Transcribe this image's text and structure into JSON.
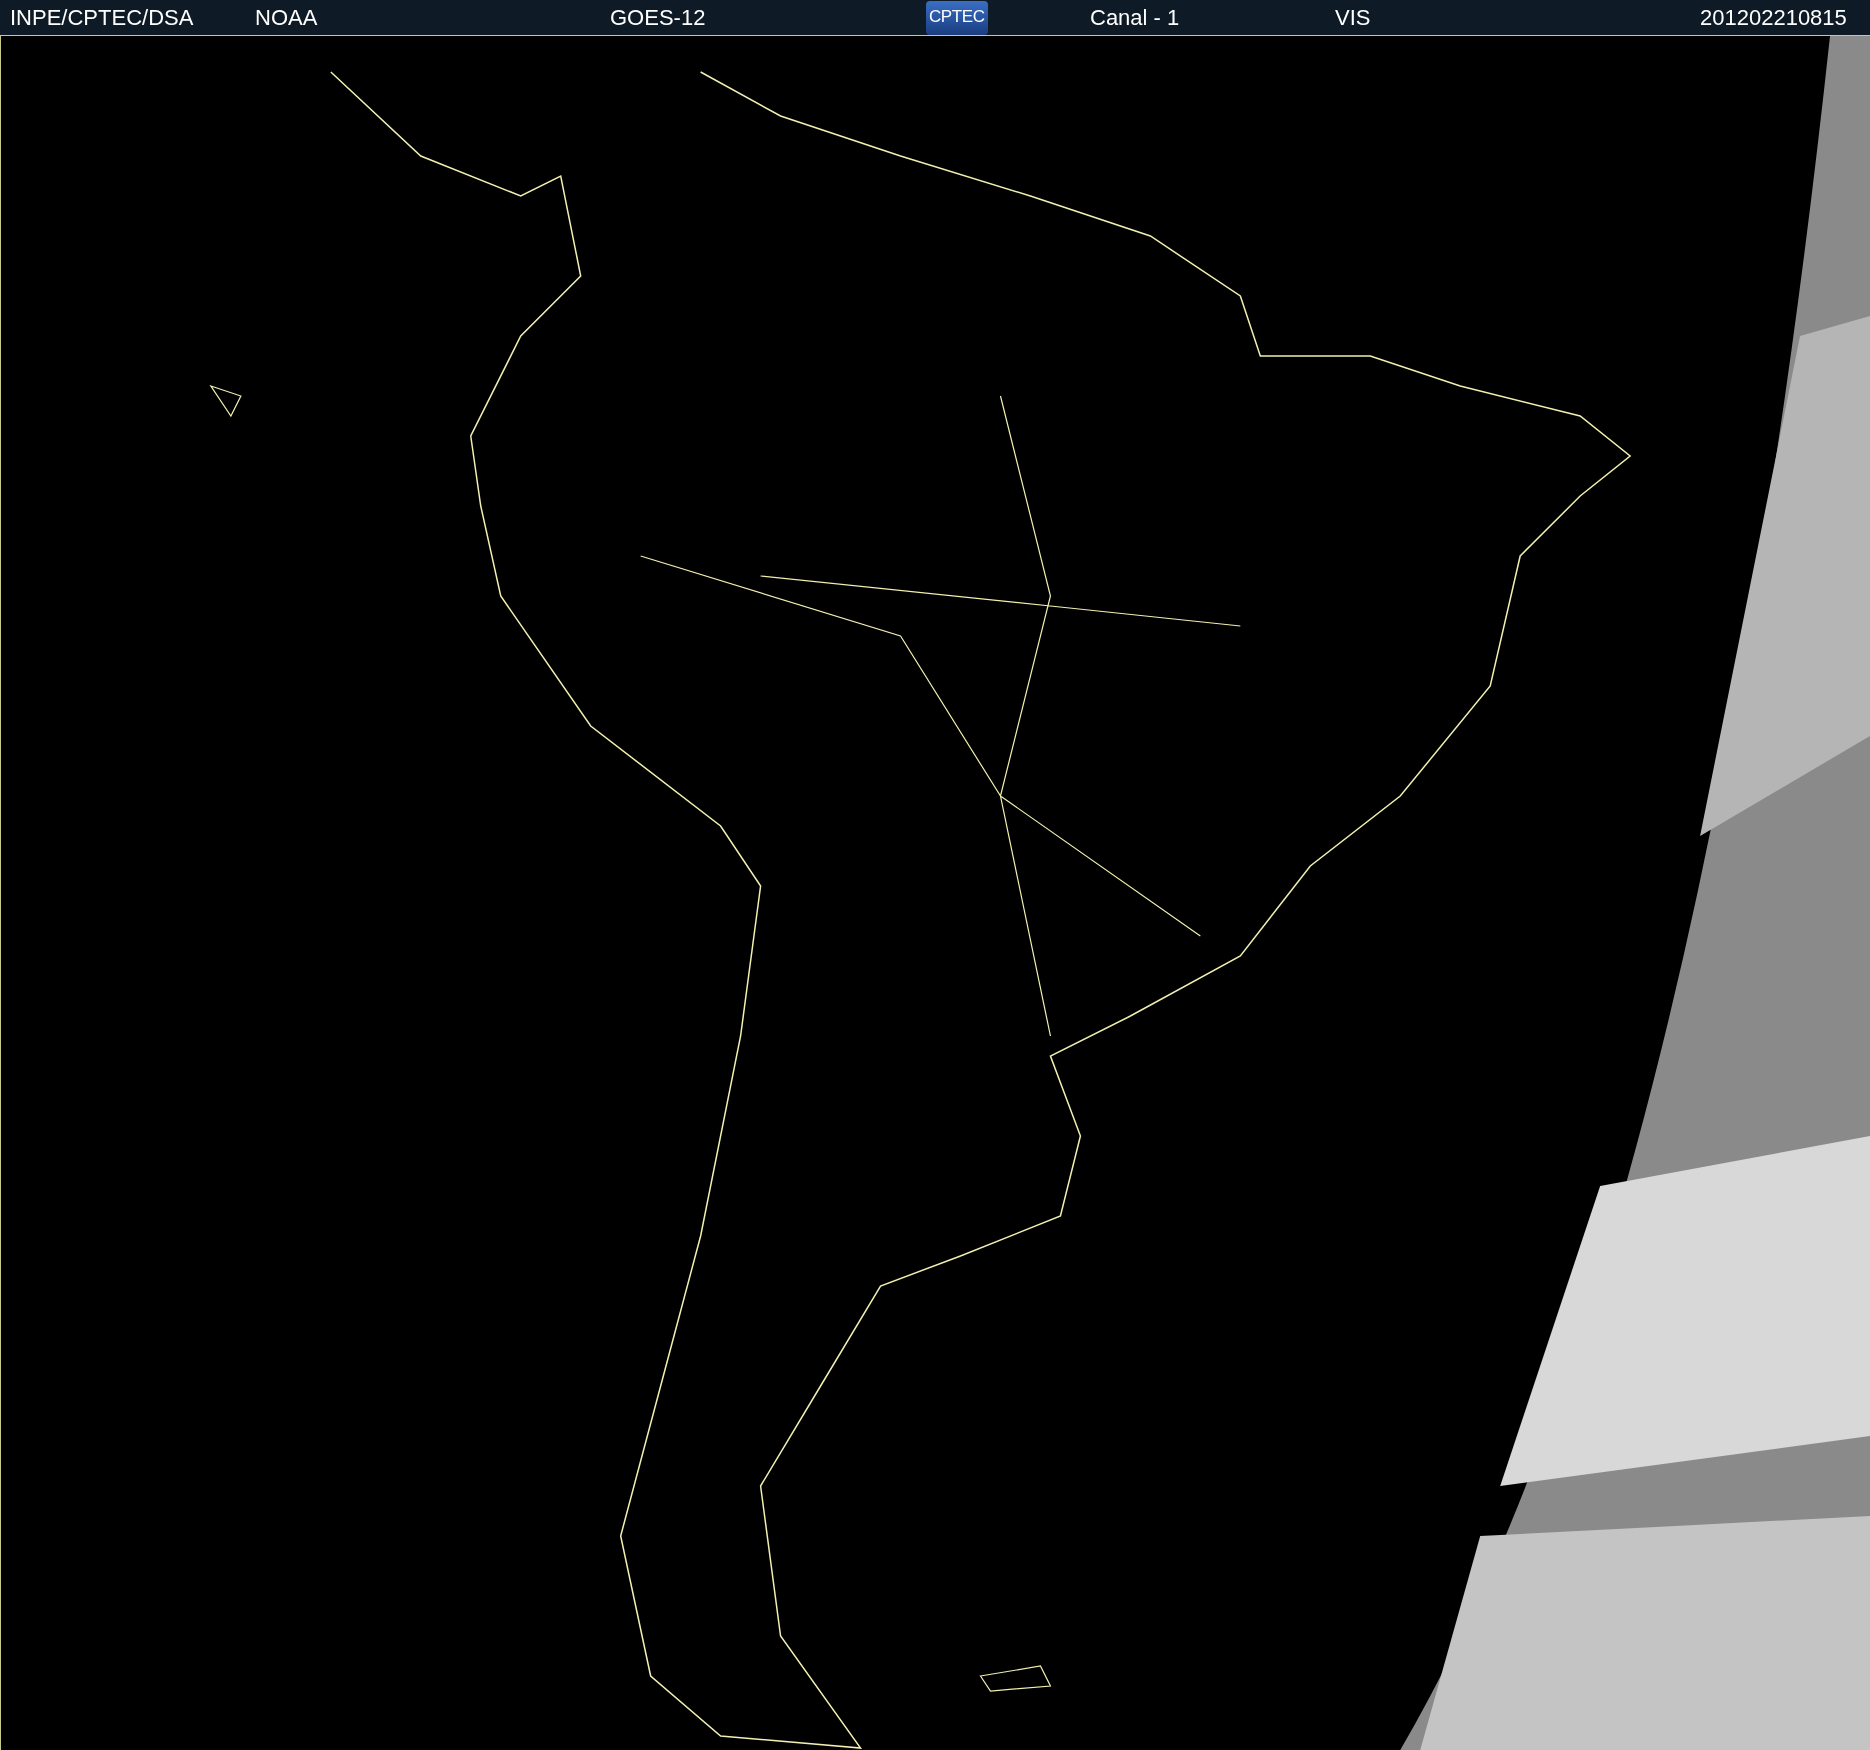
{
  "header": {
    "items": [
      {
        "kind": "text",
        "text": "INPE/CPTEC/DSA"
      },
      {
        "kind": "text",
        "text": "NOAA"
      },
      {
        "kind": "text",
        "text": "GOES-12"
      },
      {
        "kind": "logo",
        "text": "CPTEC"
      },
      {
        "kind": "text",
        "text": "Canal - 1"
      },
      {
        "kind": "text",
        "text": "VIS"
      },
      {
        "kind": "text",
        "text": "201202210815"
      }
    ]
  }
}
